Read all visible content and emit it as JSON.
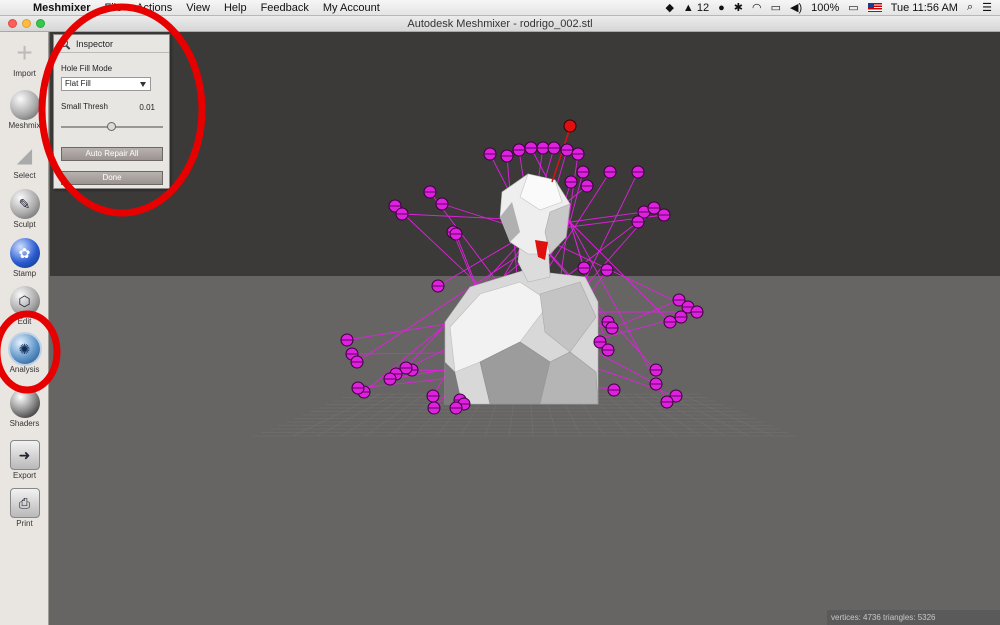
{
  "menubar": {
    "app_name": "Meshmixer",
    "menus": [
      "File",
      "Actions",
      "View",
      "Help",
      "Feedback",
      "My Account"
    ],
    "adobe_count": "12",
    "battery": "100%",
    "clock": "Tue 11:56 AM"
  },
  "window": {
    "title": "Autodesk Meshmixer - rodrigo_002.stl"
  },
  "toolbar": {
    "items": [
      {
        "label": "Import",
        "icon": "plus-icon"
      },
      {
        "label": "Meshmix",
        "icon": "bunny-icon"
      },
      {
        "label": "Select",
        "icon": "brush-icon"
      },
      {
        "label": "Sculpt",
        "icon": "sculpt-brush-icon"
      },
      {
        "label": "Stamp",
        "icon": "stamp-icon"
      },
      {
        "label": "Edit",
        "icon": "edit-mesh-icon"
      },
      {
        "label": "Analysis",
        "icon": "analysis-sphere-icon"
      },
      {
        "label": "Shaders",
        "icon": "shader-sphere-icon"
      },
      {
        "label": "Export",
        "icon": "export-icon"
      },
      {
        "label": "Print",
        "icon": "printer-icon"
      }
    ]
  },
  "inspector": {
    "title": "Inspector",
    "hole_fill_label": "Hole Fill Mode",
    "hole_fill_value": "Flat Fill",
    "small_thresh_label": "Small Thresh",
    "small_thresh_value": "0.01",
    "small_thresh_level": 0.5,
    "auto_repair_label": "Auto Repair All",
    "done_label": "Done"
  },
  "status": {
    "text": "vertices: 4736 triangles: 5326"
  },
  "colors": {
    "sky": "#3b3a39",
    "floor": "#676563",
    "marker": "#e020e0",
    "mesh": "#e4e4e4",
    "highlight_circle": "#e60000"
  }
}
